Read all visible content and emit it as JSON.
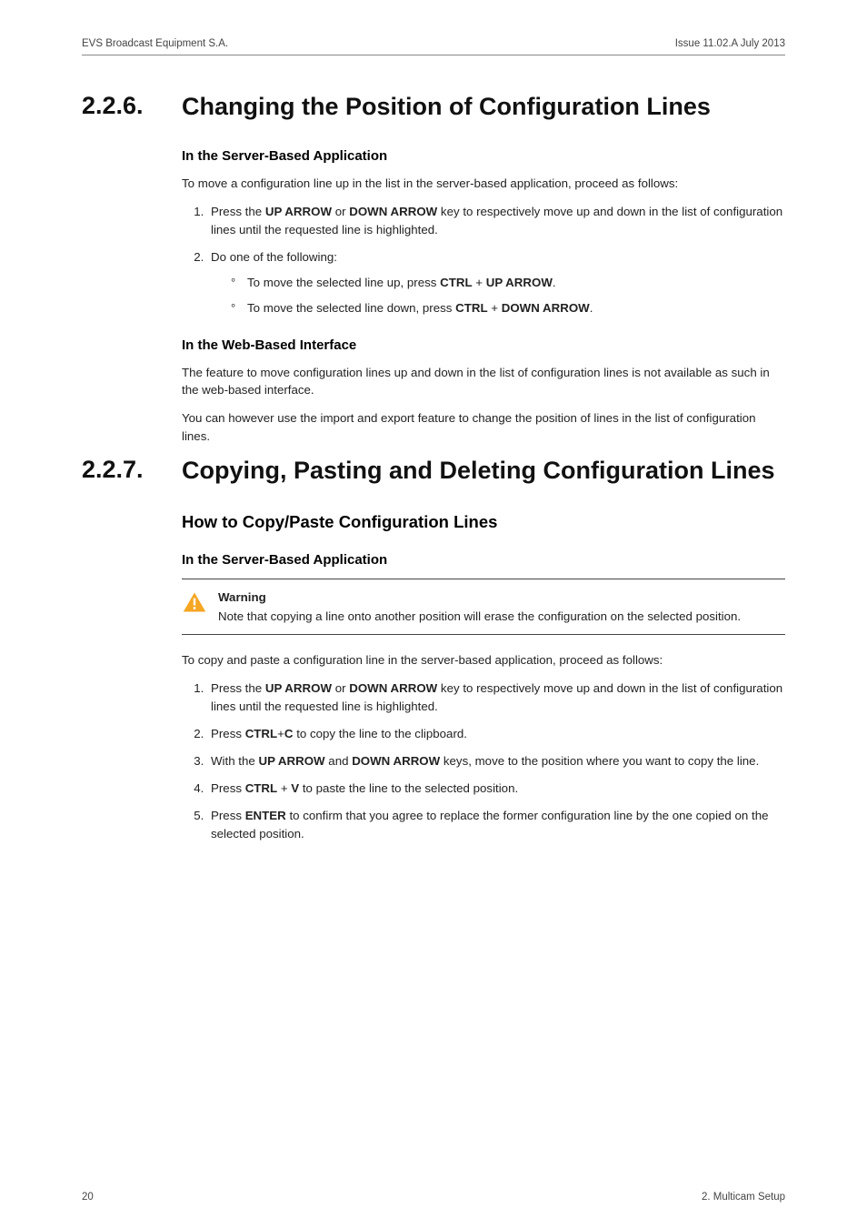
{
  "header": {
    "left": "EVS Broadcast Equipment S.A.",
    "right": "Issue 11.02.A  July 2013"
  },
  "sections": [
    {
      "num": "2.2.6.",
      "title": "Changing the Position of Configuration Lines",
      "blocks": [
        {
          "type": "h4",
          "text": "In the Server-Based Application"
        },
        {
          "type": "p",
          "text": "To move a configuration line up in the list in the server-based application, proceed as follows:"
        },
        {
          "type": "ol",
          "items": [
            {
              "segments": [
                {
                  "t": "Press the "
                },
                {
                  "t": "UP ARROW",
                  "b": true
                },
                {
                  "t": " or "
                },
                {
                  "t": "DOWN ARROW",
                  "b": true
                },
                {
                  "t": " key to respectively move up and down in the list of configuration lines until the requested line is highlighted."
                }
              ]
            },
            {
              "segments": [
                {
                  "t": "Do one of the following:"
                }
              ],
              "sub": [
                {
                  "segments": [
                    {
                      "t": "To move the selected line up, press "
                    },
                    {
                      "t": "CTRL",
                      "b": true
                    },
                    {
                      "t": " + "
                    },
                    {
                      "t": "UP ARROW",
                      "b": true
                    },
                    {
                      "t": "."
                    }
                  ]
                },
                {
                  "segments": [
                    {
                      "t": "To move the selected line down, press "
                    },
                    {
                      "t": "CTRL",
                      "b": true
                    },
                    {
                      "t": " + "
                    },
                    {
                      "t": "DOWN ARROW",
                      "b": true
                    },
                    {
                      "t": "."
                    }
                  ]
                }
              ]
            }
          ]
        },
        {
          "type": "h4",
          "text": "In the Web-Based Interface"
        },
        {
          "type": "p",
          "text": "The feature to move configuration lines up and down in the list of configuration lines is not available as such in the web-based interface."
        },
        {
          "type": "p",
          "text": "You can however use the import and export feature to change the position of lines in the list of configuration lines."
        }
      ]
    },
    {
      "num": "2.2.7.",
      "title": "Copying, Pasting and Deleting Configuration Lines",
      "blocks": [
        {
          "type": "h3",
          "text": "How to Copy/Paste Configuration Lines"
        },
        {
          "type": "h4",
          "text": "In the Server-Based Application"
        },
        {
          "type": "warning",
          "title": "Warning",
          "body": "Note that copying a line onto another position will erase the configuration on the selected position."
        },
        {
          "type": "p",
          "text": "To copy and paste a configuration line in the server-based application, proceed as follows:"
        },
        {
          "type": "ol",
          "items": [
            {
              "segments": [
                {
                  "t": "Press the "
                },
                {
                  "t": "UP ARROW",
                  "b": true
                },
                {
                  "t": " or "
                },
                {
                  "t": "DOWN ARROW",
                  "b": true
                },
                {
                  "t": " key to respectively move up and down in the list of configuration lines until the requested line is highlighted."
                }
              ]
            },
            {
              "segments": [
                {
                  "t": "Press "
                },
                {
                  "t": "CTRL",
                  "b": true
                },
                {
                  "t": "+"
                },
                {
                  "t": "C",
                  "b": true
                },
                {
                  "t": " to copy the line to the clipboard."
                }
              ]
            },
            {
              "segments": [
                {
                  "t": "With the "
                },
                {
                  "t": "UP ARROW",
                  "b": true
                },
                {
                  "t": " and "
                },
                {
                  "t": "DOWN ARROW",
                  "b": true
                },
                {
                  "t": " keys, move to the position where you want to copy the line."
                }
              ]
            },
            {
              "segments": [
                {
                  "t": "Press "
                },
                {
                  "t": "CTRL",
                  "b": true
                },
                {
                  "t": " + "
                },
                {
                  "t": "V",
                  "b": true
                },
                {
                  "t": " to paste the line to the selected position."
                }
              ]
            },
            {
              "segments": [
                {
                  "t": "Press "
                },
                {
                  "t": "ENTER",
                  "b": true
                },
                {
                  "t": " to confirm that you agree to replace the former configuration line by the one copied on the selected position."
                }
              ]
            }
          ]
        }
      ]
    }
  ],
  "footer": {
    "left": "20",
    "right": "2. Multicam Setup"
  }
}
